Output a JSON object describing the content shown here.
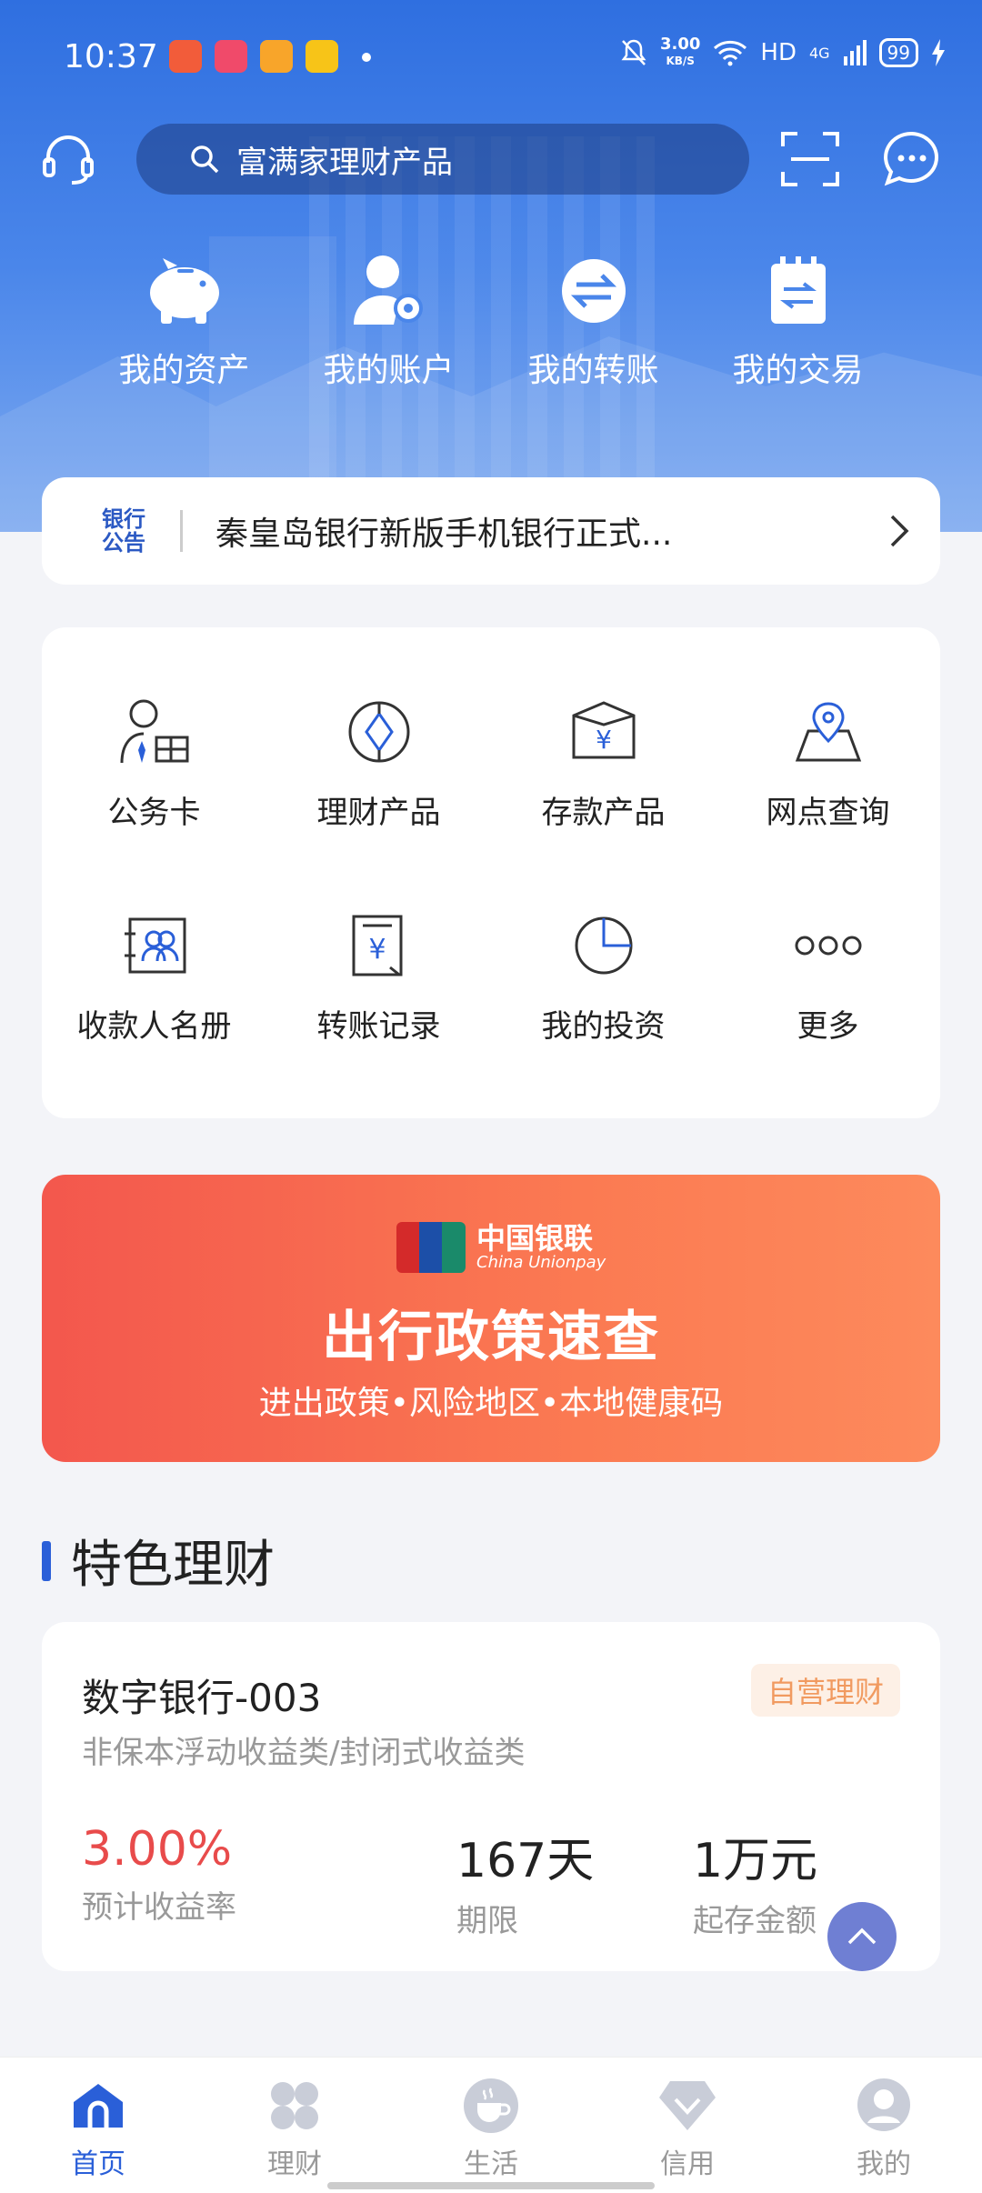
{
  "status": {
    "time": "10:37",
    "net_speed": "3.00",
    "net_unit": "KB/S",
    "hd": "HD",
    "net_type": "4G",
    "battery": "99"
  },
  "search": {
    "placeholder": "富满家理财产品"
  },
  "quick_actions": [
    {
      "label": "我的资产",
      "icon": "piggy-bank-icon"
    },
    {
      "label": "我的账户",
      "icon": "account-settings-icon"
    },
    {
      "label": "我的转账",
      "icon": "transfer-icon"
    },
    {
      "label": "我的交易",
      "icon": "transaction-icon"
    }
  ],
  "notice": {
    "tag_line1": "银行",
    "tag_line2": "公告",
    "text": "秦皇岛银行新版手机银行正式..."
  },
  "grid": [
    {
      "label": "公务卡",
      "icon": "official-card-icon"
    },
    {
      "label": "理财产品",
      "icon": "wealth-product-icon"
    },
    {
      "label": "存款产品",
      "icon": "deposit-product-icon"
    },
    {
      "label": "网点查询",
      "icon": "branch-locator-icon"
    },
    {
      "label": "收款人名册",
      "icon": "payee-list-icon"
    },
    {
      "label": "转账记录",
      "icon": "transfer-record-icon"
    },
    {
      "label": "我的投资",
      "icon": "investment-icon"
    },
    {
      "label": "更多",
      "icon": "more-icon"
    }
  ],
  "banner": {
    "logo_text_top": "UnionPay",
    "logo_text_bottom": "银联",
    "brand_cn": "中国银联",
    "brand_en": "China Unionpay",
    "title": "出行政策速查",
    "subtitle": "进出政策•风险地区•本地健康码"
  },
  "section": {
    "title": "特色理财"
  },
  "product": {
    "name": "数字银行-003",
    "badge": "自营理财",
    "desc": "非保本浮动收益类/封闭式收益类",
    "rate": "3.00%",
    "rate_label": "预计收益率",
    "term": "167天",
    "term_label": "期限",
    "min": "1万元",
    "min_label": "起存金额"
  },
  "tabs": [
    {
      "label": "首页",
      "active": true
    },
    {
      "label": "理财",
      "active": false
    },
    {
      "label": "生活",
      "active": false
    },
    {
      "label": "信用",
      "active": false
    },
    {
      "label": "我的",
      "active": false
    }
  ],
  "colors": {
    "primary": "#2a5fd8",
    "rate_red": "#e84b4b",
    "badge_orange": "#f19a60",
    "banner_start": "#f3574d",
    "banner_end": "#fd8a5c"
  }
}
